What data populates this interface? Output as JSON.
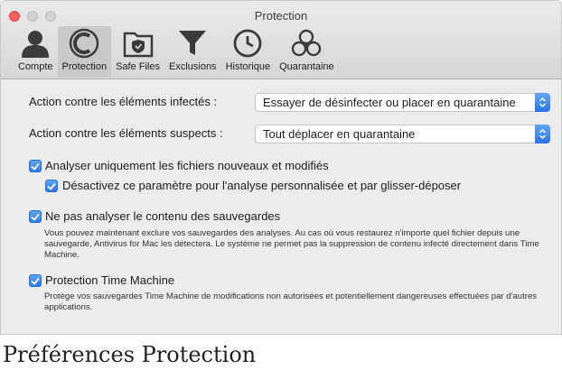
{
  "window": {
    "title": "Protection"
  },
  "toolbar": {
    "items": [
      {
        "label": "Compte",
        "icon": "account-icon",
        "selected": false
      },
      {
        "label": "Protection",
        "icon": "protection-icon",
        "selected": true
      },
      {
        "label": "Safe Files",
        "icon": "safe-files-icon",
        "selected": false
      },
      {
        "label": "Exclusions",
        "icon": "filter-icon",
        "selected": false
      },
      {
        "label": "Historique",
        "icon": "clock-icon",
        "selected": false
      },
      {
        "label": "Quarantaine",
        "icon": "biohazard-icon",
        "selected": false
      }
    ]
  },
  "settings": {
    "infected_label": "Action contre les éléments infectés :",
    "infected_value": "Essayer de désinfecter ou placer en quarantaine",
    "suspect_label": "Action contre les éléments suspects :",
    "suspect_value": "Tout déplacer en quarantaine",
    "scan_new_label": "Analyser uniquement les fichiers nouveaux et modifiés",
    "scan_new_checked": true,
    "disable_param_label": "Désactivez ce paramètre pour l'analyse personnalisée et par glisser-déposer",
    "disable_param_checked": true,
    "no_backup_label": "Ne pas analyser le contenu des sauvegardes",
    "no_backup_checked": true,
    "no_backup_desc": "Vous pouvez maintenant exclure vos sauvegardes des analyses. Au cas où vous restaurez n'importe quel fichier depuis une sauvegarde, Antivirus for Mac les détectera. Le système ne permet pas la suppression de contenu infecté directement dans Time Machine.",
    "time_machine_label": "Protection Time Machine",
    "time_machine_checked": true,
    "time_machine_desc": "Protège vos sauvegardes Time Machine de modifications non autorisées et potentiellement dangereuses effectuées par d'autres applications."
  },
  "caption": "Préférences Protection",
  "colors": {
    "accent": "#2d78ea",
    "close": "#fc605c"
  }
}
